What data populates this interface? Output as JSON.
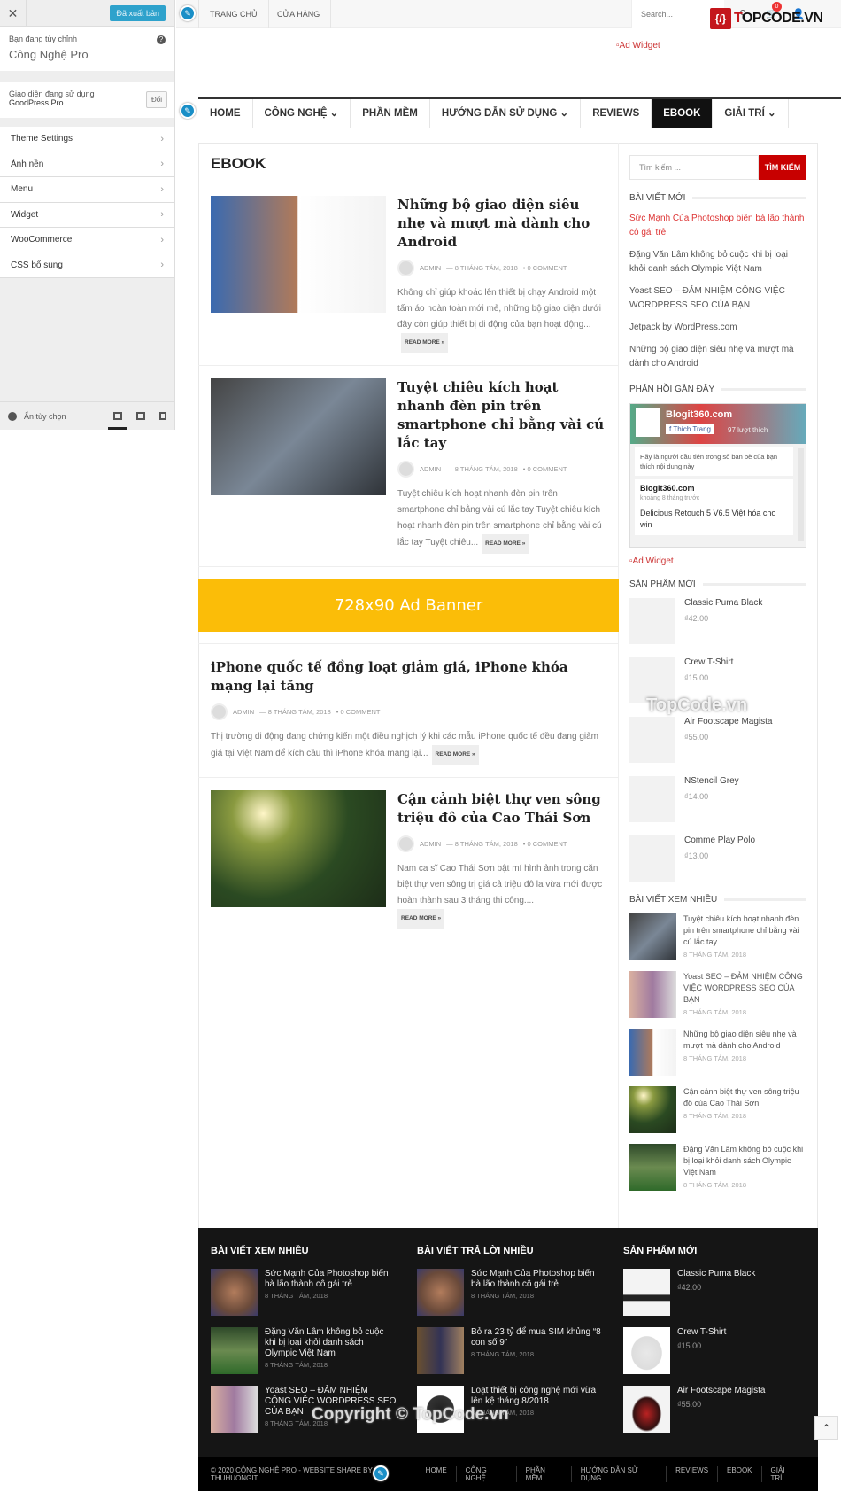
{
  "customizer": {
    "close_icon": "close-icon",
    "publish_label": "Đã xuất bản",
    "customizing_label": "Bạn đang tùy chỉnh",
    "site_name": "Công Nghệ Pro",
    "active_theme_label": "Giao diện đang sử dụng",
    "active_theme": "GoodPress Pro",
    "change_label": "Đổi",
    "menu": [
      {
        "label": "Theme Settings"
      },
      {
        "label": "Ảnh nền"
      },
      {
        "label": "Menu"
      },
      {
        "label": "Widget"
      },
      {
        "label": "WooCommerce"
      },
      {
        "label": "CSS bổ sung"
      }
    ],
    "hide_label": "Ẩn tùy chọn",
    "devices": [
      "desktop",
      "tablet",
      "mobile"
    ],
    "active_device": "desktop"
  },
  "topbar": {
    "menu": [
      {
        "label": "TRANG CHỦ"
      },
      {
        "label": "CỬA HÀNG"
      }
    ],
    "search_placeholder": "Search...",
    "cart_count": "0"
  },
  "logo": {
    "mark": "{/}",
    "text_a": "T",
    "text_b": "OPCODE.VN"
  },
  "header_ad": "Ad Widget",
  "nav": [
    {
      "label": "HOME"
    },
    {
      "label": "CÔNG NGHỆ ⌄"
    },
    {
      "label": "PHẦN MỀM"
    },
    {
      "label": "HƯỚNG DẪN SỬ DỤNG ⌄"
    },
    {
      "label": "REVIEWS"
    },
    {
      "label": "EBOOK",
      "active": true
    },
    {
      "label": "GIẢI TRÍ ⌄"
    }
  ],
  "main": {
    "heading": "EBOOK",
    "read_more": "READ MORE »",
    "banner": "728x90 Ad Banner",
    "posts": [
      {
        "title": "Những bộ giao diện siêu nhẹ và mượt mà dành cho Android",
        "author": "ADMIN",
        "date": "— 8 THÁNG TÁM, 2018",
        "comments": "•  0 COMMENT",
        "excerpt": "Không chỉ giúp khoác lên thiết bị chạy Android một tấm áo hoàn toàn mới mẻ, những bộ giao diện dưới đây còn giúp thiết bị di động của bạn hoạt động..."
      },
      {
        "title": "Tuyệt chiêu kích hoạt nhanh đèn pin trên smartphone chỉ bằng vài cú lắc tay",
        "author": "ADMIN",
        "date": "— 8 THÁNG TÁM, 2018",
        "comments": "•  0 COMMENT",
        "excerpt": "Tuyệt chiêu kích hoạt nhanh đèn pin trên smartphone chỉ bằng vài cú lắc tay Tuyệt chiêu kích hoạt nhanh đèn pin trên smartphone chỉ bằng vài cú lắc tay Tuyệt chiêu..."
      },
      {
        "title": "iPhone quốc tế đồng loạt giảm giá, iPhone khóa mạng lại tăng",
        "author": "ADMIN",
        "date": "— 8 THÁNG TÁM, 2018",
        "comments": "•  0 COMMENT",
        "excerpt": "Thị trường di động đang chứng kiến một điều nghịch lý khi các mẫu iPhone quốc tế đều đang giảm giá tại Việt Nam để kích cầu thì iPhone khóa mạng lại..."
      },
      {
        "title": "Cận cảnh biệt thự ven sông triệu đô của Cao Thái Sơn",
        "author": "ADMIN",
        "date": "— 8 THÁNG TÁM, 2018",
        "comments": "•  0 COMMENT",
        "excerpt": "Nam ca sĩ Cao Thái Sơn bật mí hình ảnh trong căn biệt thự ven sông trị giá cả triệu đô la vừa mới được hoàn thành sau 3 tháng thi công...."
      }
    ]
  },
  "sidebar": {
    "search_placeholder": "Tìm kiếm ...",
    "search_button": "TÌM KIẾM",
    "recent_title": "BÀI VIẾT MỚI",
    "recent": [
      "Sức Mạnh Của Photoshop biến bà lão thành cô gái trẻ",
      "Đặng Văn Lâm không bỏ cuộc khi bị loại khỏi danh sách Olympic Việt Nam",
      "Yoast SEO – ĐẢM NHIỆM CÔNG VIỆC WORDPRESS SEO CỦA BẠN",
      "Jetpack by WordPress.com",
      "Những bộ giao diện siêu nhẹ và mượt mà dành cho Android"
    ],
    "comments_title": "PHẢN HỒI GẦN ĐÂY",
    "fb": {
      "page": "Blogit360.com",
      "like": "Thích Trang",
      "likes": "97 lượt thích",
      "friends": "Hãy là người đầu tiên trong số bạn bè của bạn thích nội dung này",
      "post_page": "Blogit360.com",
      "post_time": "khoảng 8 tháng trước",
      "post_text": "Delicious Retouch 5 V6.5 Việt hóa cho win"
    },
    "ad": "Ad Widget",
    "products_title": "SẢN PHẨM MỚI",
    "products": [
      {
        "name": "Classic Puma Black",
        "price": "₫42.00"
      },
      {
        "name": "Crew T-Shirt",
        "price": "₫15.00"
      },
      {
        "name": "Air Footscape Magista",
        "price": "₫55.00"
      },
      {
        "name": "NStencil Grey",
        "price": "₫14.00"
      },
      {
        "name": "Comme Play Polo",
        "price": "₫13.00"
      }
    ],
    "popular_title": "BÀI VIẾT XEM NHIỀU",
    "popular": [
      {
        "title": "Tuyệt chiêu kích hoạt nhanh đèn pin trên smartphone chỉ bằng vài cú lắc tay",
        "date": "8 THÁNG TÁM, 2018"
      },
      {
        "title": "Yoast SEO – ĐẢM NHIỆM CÔNG VIỆC WORDPRESS SEO CỦA BẠN",
        "date": "8 THÁNG TÁM, 2018"
      },
      {
        "title": "Những bộ giao diện siêu nhẹ và mượt mà dành cho Android",
        "date": "8 THÁNG TÁM, 2018"
      },
      {
        "title": "Cận cảnh biệt thự ven sông triệu đô của Cao Thái Sơn",
        "date": "8 THÁNG TÁM, 2018"
      },
      {
        "title": "Đặng Văn Lâm không bỏ cuộc khi bị loại khỏi danh sách Olympic Việt Nam",
        "date": "8 THÁNG TÁM, 2018"
      }
    ]
  },
  "footer": {
    "col1_title": "BÀI VIẾT XEM NHIỀU",
    "col1": [
      {
        "title": "Sức Mạnh Của Photoshop biến bà lão thành cô gái trẻ",
        "date": "8 THÁNG TÁM, 2018"
      },
      {
        "title": "Đặng Văn Lâm không bỏ cuộc khi bị loại khỏi danh sách Olympic Việt Nam",
        "date": "8 THÁNG TÁM, 2018"
      },
      {
        "title": "Yoast SEO – ĐẢM NHIỆM CÔNG VIỆC WORDPRESS SEO CỦA BẠN",
        "date": "8 THÁNG TÁM, 2018"
      }
    ],
    "col2_title": "BÀI VIẾT TRẢ LỜI NHIỀU",
    "col2": [
      {
        "title": "Sức Mạnh Của Photoshop biến bà lão thành cô gái trẻ",
        "date": "8 THÁNG TÁM, 2018"
      },
      {
        "title": "Bỏ ra 23 tỷ để mua SIM khủng “8 con số 9”",
        "date": "8 THÁNG TÁM, 2018"
      },
      {
        "title": "Loạt thiết bị công nghệ mới vừa lên kệ tháng 8/2018",
        "date": "8 THÁNG TÁM, 2018"
      }
    ],
    "col3_title": "SẢN PHẨM MỚI",
    "col3": [
      {
        "name": "Classic Puma Black",
        "price": "₫42.00"
      },
      {
        "name": "Crew T-Shirt",
        "price": "₫15.00"
      },
      {
        "name": "Air Footscape Magista",
        "price": "₫55.00"
      }
    ],
    "copyright": "© 2020 CÔNG NGHỆ PRO - WEBSITE SHARE BY THUHUONGIT",
    "links": [
      "HOME",
      "CÔNG NGHỆ",
      "PHẦN MỀM",
      "HƯỚNG DẪN SỬ DỤNG",
      "REVIEWS",
      "EBOOK",
      "GIẢI TRÍ"
    ]
  },
  "watermarks": {
    "center": "TopCode.vn",
    "footer": "Copyright © TopCode.vn"
  },
  "colors": {
    "accent": "#c80000",
    "publish": "#2ea2cc",
    "banner": "#fbbd08",
    "footer": "#151515"
  }
}
